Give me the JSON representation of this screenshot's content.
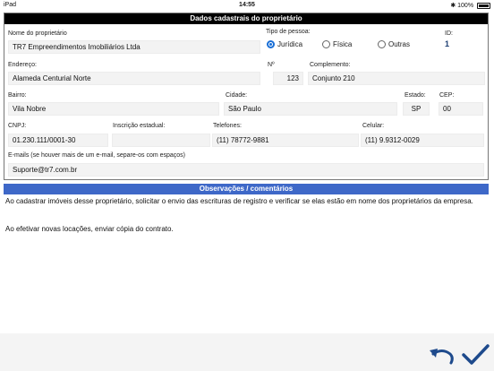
{
  "status_bar": {
    "device": "iPad",
    "time": "14:55",
    "battery": "100%"
  },
  "form": {
    "title": "Dados cadastrais do proprietário",
    "fields": {
      "nome": {
        "label": "Nome do proprietário",
        "value": "TR7 Empreendimentos Imobiliários Ltda"
      },
      "tipo_pessoa": {
        "label": "Tipo de pessoa:",
        "options": [
          "Jurídica",
          "Física",
          "Outras"
        ],
        "selected": "Jurídica"
      },
      "id": {
        "label": "ID:",
        "value": "1"
      },
      "endereco": {
        "label": "Endereço:",
        "value": "Alameda Centurial Norte"
      },
      "numero": {
        "label": "Nº",
        "value": "123"
      },
      "complemento": {
        "label": "Complemento:",
        "value": "Conjunto 210"
      },
      "bairro": {
        "label": "Bairro:",
        "value": "Vila Nobre"
      },
      "cidade": {
        "label": "Cidade:",
        "value": "São Paulo"
      },
      "estado": {
        "label": "Estado:",
        "value": "SP"
      },
      "cep": {
        "label": "CEP:",
        "value": "00"
      },
      "cnpj": {
        "label": "CNPJ:",
        "value": "01.230.111/0001-30"
      },
      "inscricao": {
        "label": "Inscrição estadual:",
        "value": ""
      },
      "telefones": {
        "label": "Telefones:",
        "value": "(11) 78772-9881"
      },
      "celular": {
        "label": "Celular:",
        "value": "(11) 9.9312-0029"
      },
      "emails": {
        "label": "E-mails (se houver mais de um e-mail, separe-os com espaços)",
        "value": "Suporte@tr7.com.br"
      }
    }
  },
  "observacoes": {
    "title": "Observações / comentários",
    "paragraphs": [
      "Ao cadastrar imóveis desse proprietário, solicitar o envio das escrituras de registro e verificar se elas estão em nome dos proprietários da empresa.",
      "Ao efetivar novas locações, enviar cópia do contrato."
    ]
  },
  "actions": {
    "undo_icon": "undo-icon",
    "confirm_icon": "checkmark-icon",
    "accent": "#1e4a8c"
  },
  "colors": {
    "header": "#000000",
    "obs_header": "#3e68c8",
    "radio_selected": "#1a6fd6"
  }
}
